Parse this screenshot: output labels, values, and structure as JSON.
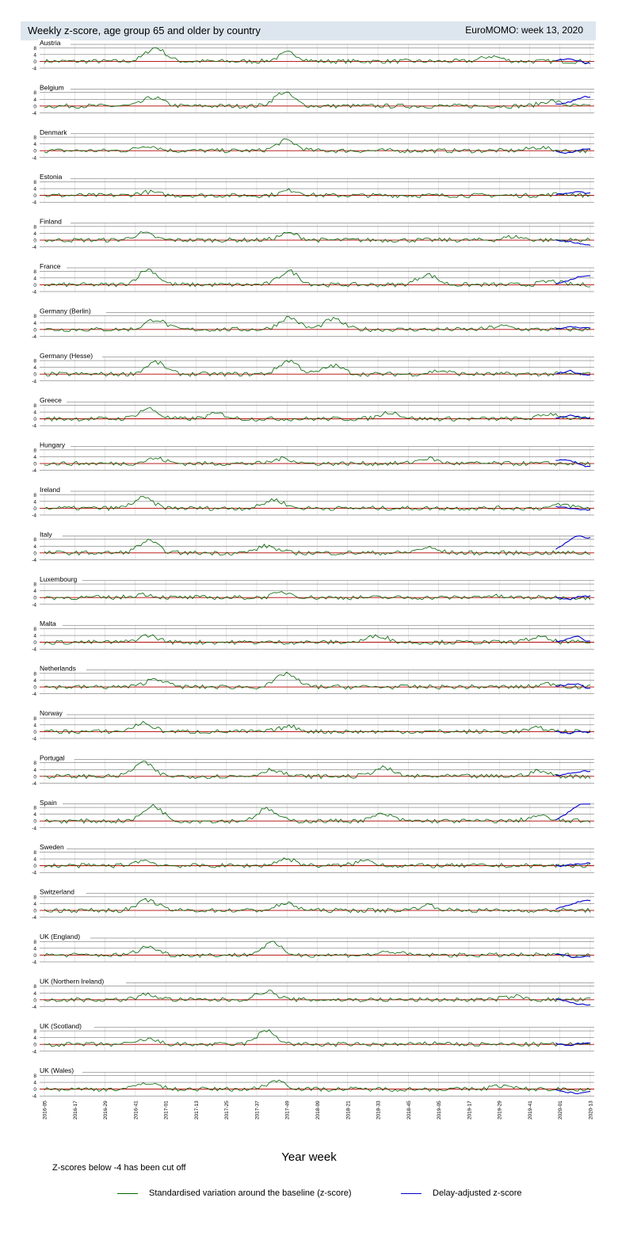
{
  "header": {
    "title": "Weekly z-score, age group 65 and older by country",
    "week": "EuroMOMO: week 13, 2020"
  },
  "chart_data": {
    "type": "line",
    "panels": [
      {
        "name": "Austria",
        "peaks": [
          [
            45,
            8
          ],
          [
            99,
            5
          ],
          [
            181,
            3
          ]
        ],
        "delay": [
          0.6,
          1.0,
          1.4,
          0.5,
          -1.2
        ]
      },
      {
        "name": "Belgium",
        "peaks": [
          [
            44,
            5
          ],
          [
            97,
            8
          ],
          [
            205,
            3
          ]
        ],
        "delay": [
          0.8,
          1.5,
          2.5,
          4.0,
          5.5
        ]
      },
      {
        "name": "Denmark",
        "peaks": [
          [
            42,
            3
          ],
          [
            98,
            6
          ],
          [
            200,
            2
          ]
        ],
        "delay": [
          -0.5,
          -1.5,
          -1.0,
          0.5,
          1.2
        ]
      },
      {
        "name": "Estonia",
        "peaks": [
          [
            42,
            2
          ],
          [
            100,
            3
          ],
          [
            210,
            1
          ]
        ],
        "delay": [
          0.5,
          1.0,
          1.5,
          2.0,
          1.5
        ]
      },
      {
        "name": "Finland",
        "peaks": [
          [
            40,
            4
          ],
          [
            99,
            4
          ],
          [
            190,
            2
          ]
        ],
        "delay": [
          0.2,
          -0.5,
          -1.0,
          -2.0,
          -3.0
        ]
      },
      {
        "name": "France",
        "peaks": [
          [
            42,
            9
          ],
          [
            99,
            8
          ],
          [
            155,
            6
          ],
          [
            205,
            2
          ]
        ],
        "delay": [
          0.5,
          1.5,
          3.0,
          4.5,
          5.5
        ]
      },
      {
        "name": "Germany (Berlin)",
        "peaks": [
          [
            45,
            6
          ],
          [
            99,
            7
          ],
          [
            117,
            6
          ],
          [
            185,
            2
          ]
        ],
        "delay": [
          0.5,
          1.0,
          1.5,
          1.0,
          0.8
        ]
      },
      {
        "name": "Germany (Hesse)",
        "peaks": [
          [
            45,
            7
          ],
          [
            99,
            8
          ],
          [
            117,
            5
          ],
          [
            160,
            2
          ]
        ],
        "delay": [
          0.5,
          1.0,
          2.0,
          0.5,
          -0.5
        ]
      },
      {
        "name": "Greece",
        "peaks": [
          [
            42,
            6
          ],
          [
            70,
            3
          ],
          [
            140,
            4
          ],
          [
            205,
            3
          ]
        ],
        "delay": [
          0.5,
          1.0,
          2.0,
          1.5,
          0.5
        ]
      },
      {
        "name": "Hungary",
        "peaks": [
          [
            45,
            3
          ],
          [
            97,
            3
          ],
          [
            155,
            3
          ]
        ],
        "delay": [
          1.5,
          2.0,
          1.5,
          0.0,
          -1.5
        ]
      },
      {
        "name": "Ireland",
        "peaks": [
          [
            40,
            6
          ],
          [
            93,
            5
          ],
          [
            210,
            2
          ]
        ],
        "delay": [
          1.0,
          0.5,
          0.0,
          -0.5,
          -1.0
        ]
      },
      {
        "name": "Italy",
        "peaks": [
          [
            42,
            7
          ],
          [
            90,
            4
          ],
          [
            155,
            3
          ]
        ],
        "delay": [
          2.0,
          5.0,
          8.0,
          10.0,
          9.0
        ]
      },
      {
        "name": "Luxembourg",
        "peaks": [
          [
            40,
            2
          ],
          [
            97,
            3
          ],
          [
            180,
            1
          ]
        ],
        "delay": [
          0.5,
          -0.5,
          -1.0,
          0.5,
          0.8
        ]
      },
      {
        "name": "Malta",
        "peaks": [
          [
            42,
            4
          ],
          [
            135,
            4
          ],
          [
            200,
            3
          ]
        ],
        "delay": [
          0.5,
          1.0,
          2.5,
          4.0,
          1.0
        ]
      },
      {
        "name": "Netherlands",
        "peaks": [
          [
            45,
            5
          ],
          [
            98,
            8
          ],
          [
            205,
            2
          ]
        ],
        "delay": [
          0.5,
          1.0,
          1.5,
          2.0,
          -0.5
        ]
      },
      {
        "name": "Norway",
        "peaks": [
          [
            40,
            5
          ],
          [
            99,
            3
          ],
          [
            200,
            2
          ]
        ],
        "delay": [
          0.3,
          -0.5,
          -0.8,
          0.2,
          -0.3
        ]
      },
      {
        "name": "Portugal",
        "peaks": [
          [
            40,
            8
          ],
          [
            92,
            4
          ],
          [
            137,
            5
          ],
          [
            200,
            3
          ]
        ],
        "delay": [
          0.5,
          1.0,
          2.0,
          2.5,
          3.0
        ]
      },
      {
        "name": "Spain",
        "peaks": [
          [
            44,
            9
          ],
          [
            90,
            7
          ],
          [
            137,
            4
          ],
          [
            200,
            3
          ]
        ],
        "delay": [
          1.0,
          3.0,
          6.0,
          9.0,
          11.0
        ]
      },
      {
        "name": "Sweden",
        "peaks": [
          [
            40,
            3
          ],
          [
            98,
            4
          ],
          [
            130,
            3
          ]
        ],
        "delay": [
          0.5,
          -0.5,
          0.5,
          1.0,
          1.5
        ]
      },
      {
        "name": "Switzerland",
        "peaks": [
          [
            42,
            6
          ],
          [
            98,
            4
          ],
          [
            155,
            3
          ]
        ],
        "delay": [
          1.0,
          2.0,
          3.0,
          5.0,
          6.0
        ]
      },
      {
        "name": "UK (England)",
        "peaks": [
          [
            42,
            5
          ],
          [
            92,
            7
          ],
          [
            140,
            2
          ]
        ],
        "delay": [
          1.0,
          0.0,
          -1.0,
          -1.5,
          -0.5
        ]
      },
      {
        "name": "UK (Northern Ireland)",
        "peaks": [
          [
            42,
            3
          ],
          [
            90,
            5
          ],
          [
            190,
            2
          ]
        ],
        "delay": [
          0.5,
          -0.5,
          -1.5,
          -2.5,
          -3.0
        ]
      },
      {
        "name": "UK (Scotland)",
        "peaks": [
          [
            42,
            3
          ],
          [
            90,
            8
          ],
          [
            160,
            1
          ]
        ],
        "delay": [
          0.5,
          0.0,
          -0.5,
          0.5,
          1.0
        ]
      },
      {
        "name": "UK (Wales)",
        "peaks": [
          [
            42,
            4
          ],
          [
            94,
            5
          ],
          [
            185,
            2
          ]
        ],
        "delay": [
          -0.5,
          -1.5,
          -2.0,
          -2.5,
          -1.5
        ]
      }
    ],
    "weeks_total": 222,
    "ylim": [
      -4,
      10
    ],
    "yticks": [
      "8",
      "4",
      "0",
      "-4"
    ],
    "xticks": [
      "2016-05",
      "2016-17",
      "2016-29",
      "2016-41",
      "2017-01",
      "2017-13",
      "2017-25",
      "2017-37",
      "2017-49",
      "2018-09",
      "2018-21",
      "2018-33",
      "2018-45",
      "2019-05",
      "2019-17",
      "2019-29",
      "2019-41",
      "2020-01",
      "2020-13"
    ],
    "xlabel": "Year week",
    "note": "Z-scores below -4 has been cut off",
    "legend": [
      {
        "label": "Standardised variation around the baseline (z-score)",
        "color": "#006400"
      },
      {
        "label": "Delay-adjusted z-score",
        "color": "#0000cc"
      }
    ],
    "colors": {
      "zscore": "#006400",
      "delay": "#0000cc",
      "baseline": "#b00000",
      "grid": "#555555"
    }
  }
}
